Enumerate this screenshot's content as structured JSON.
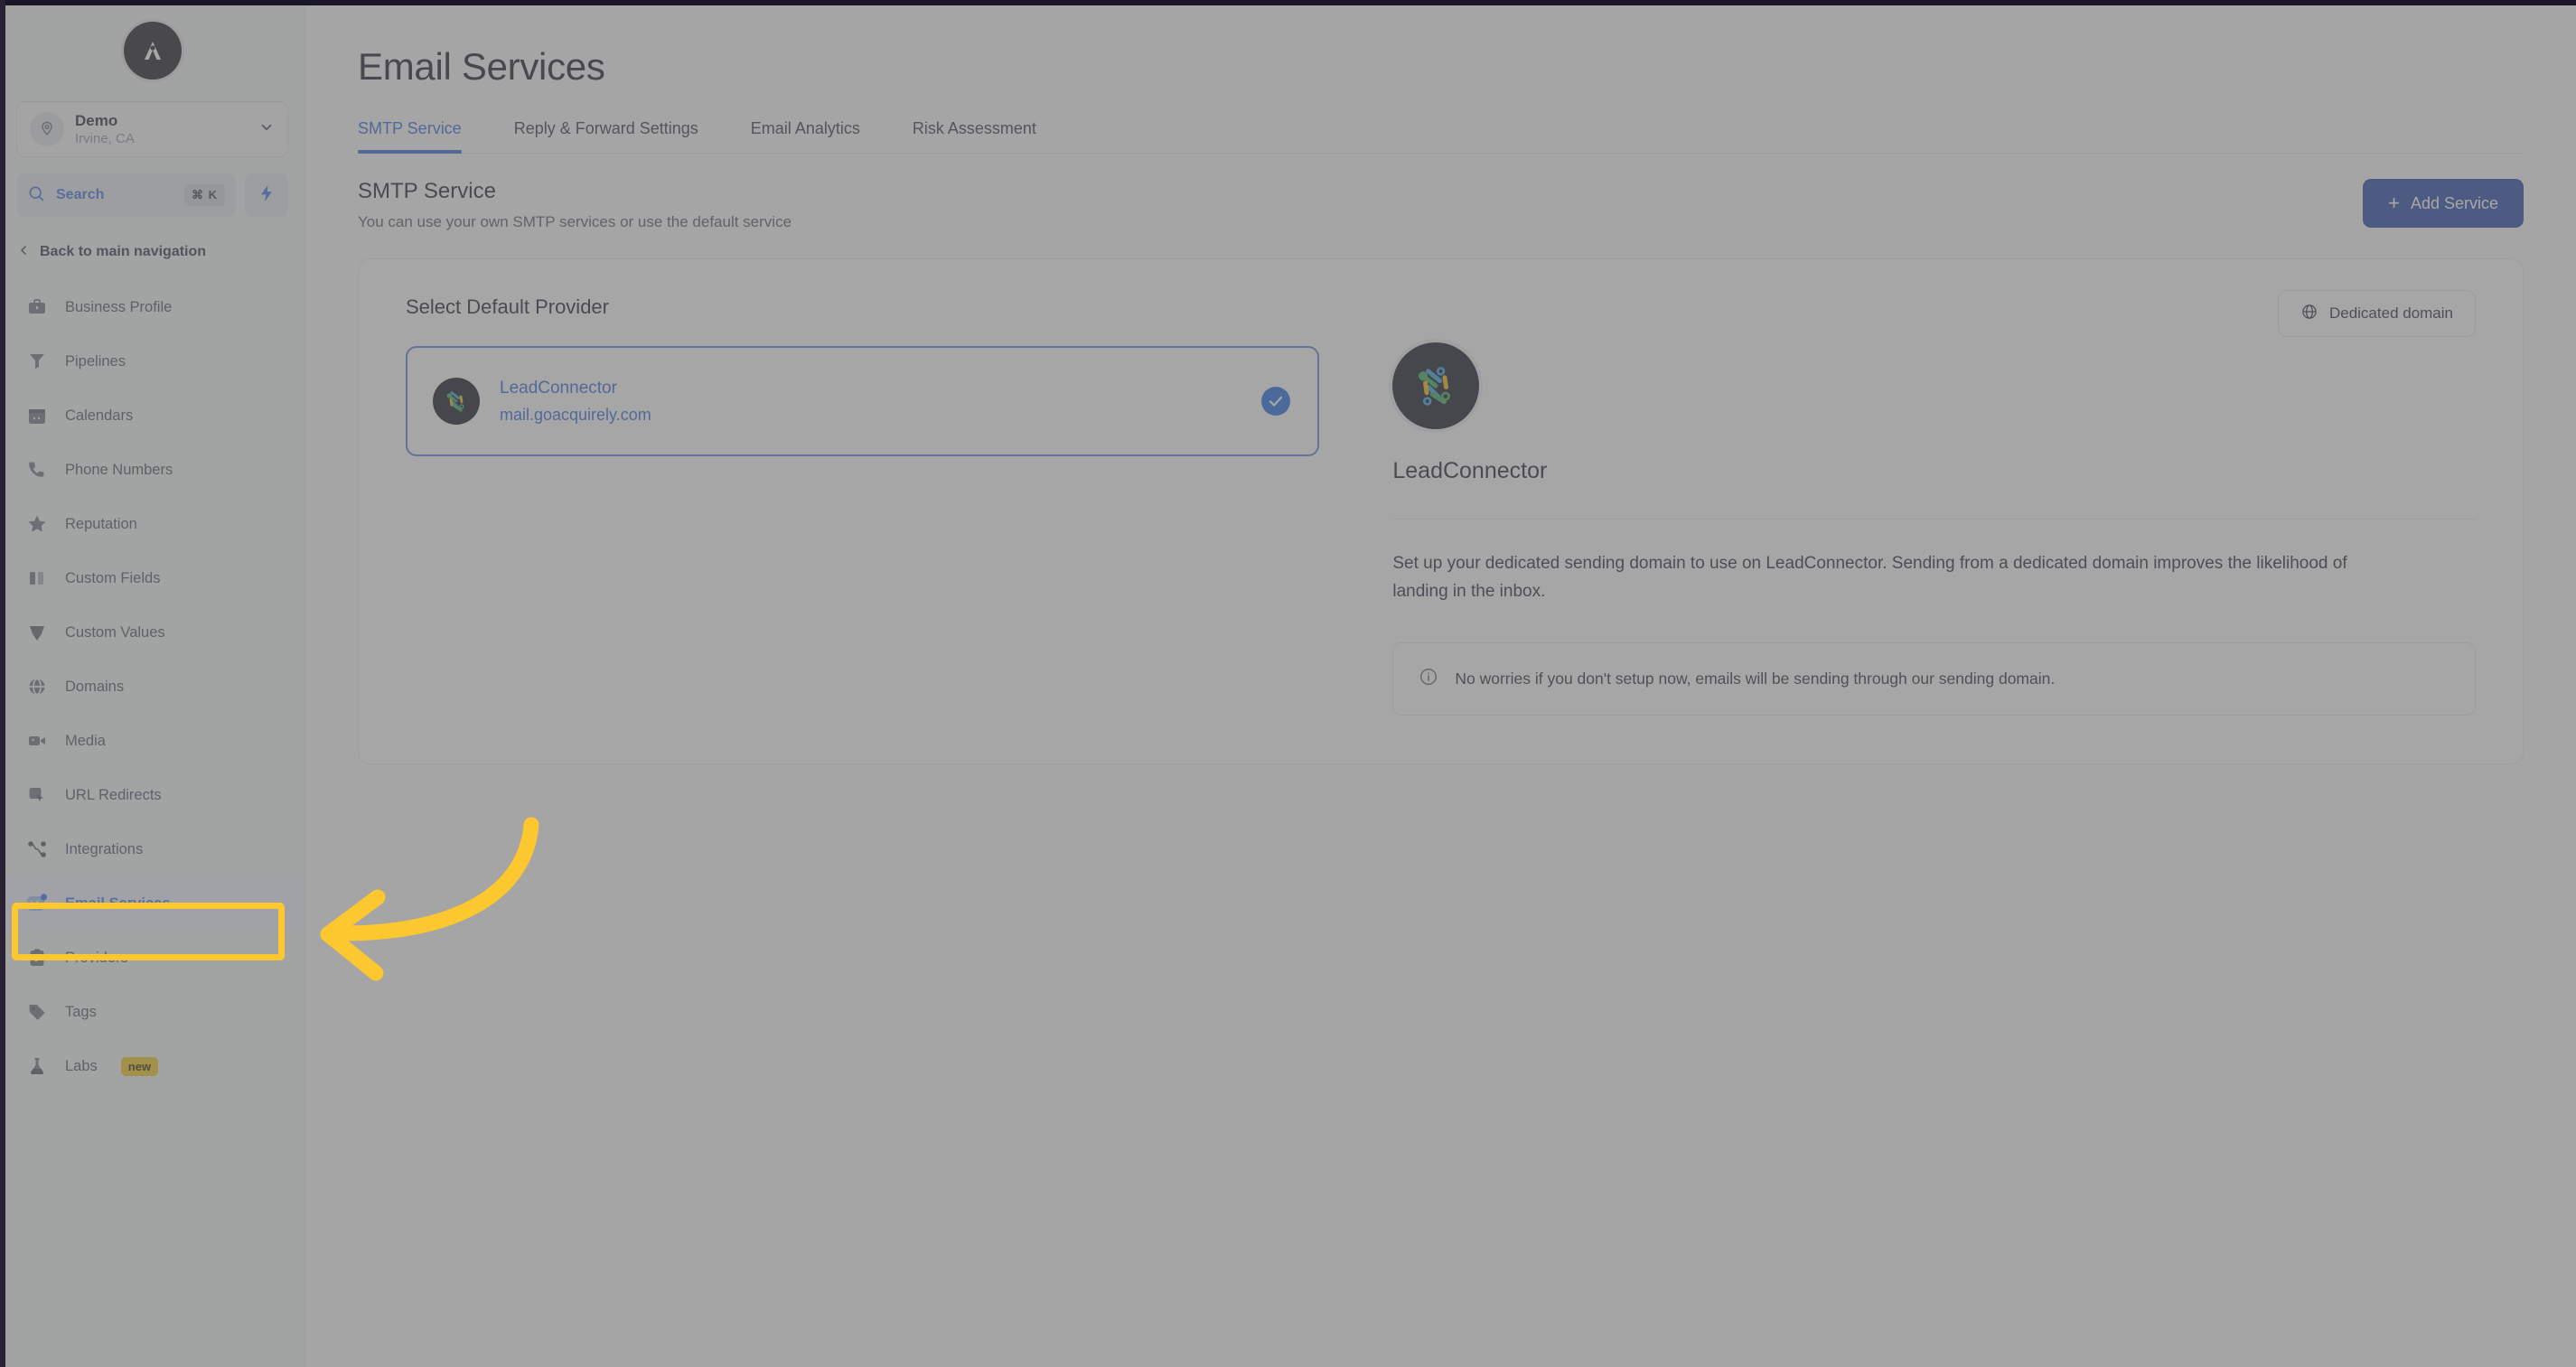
{
  "sidebar": {
    "logo_icon": "logo-a-icon",
    "location": {
      "name": "Demo",
      "sublabel": "Irvine, CA",
      "avatar_icon": "location-pin-icon",
      "chevron_icon": "chevron-down-icon"
    },
    "search": {
      "label": "Search",
      "shortcut": "⌘ K",
      "icon": "search-icon",
      "quick_action_icon": "lightning-bolt-icon"
    },
    "back_nav": {
      "label": "Back to main navigation",
      "icon": "chevron-left-icon"
    },
    "items": [
      {
        "label": "Business Profile",
        "icon": "briefcase-icon",
        "active": false
      },
      {
        "label": "Pipelines",
        "icon": "funnel-icon",
        "active": false
      },
      {
        "label": "Calendars",
        "icon": "calendar-icon",
        "active": false
      },
      {
        "label": "Phone Numbers",
        "icon": "phone-icon",
        "active": false
      },
      {
        "label": "Reputation",
        "icon": "star-icon",
        "active": false
      },
      {
        "label": "Custom Fields",
        "icon": "columns-icon",
        "active": false
      },
      {
        "label": "Custom Values",
        "icon": "shield-icon",
        "active": false
      },
      {
        "label": "Domains",
        "icon": "globe-icon",
        "active": false
      },
      {
        "label": "Media",
        "icon": "video-camera-icon",
        "active": false
      },
      {
        "label": "URL Redirects",
        "icon": "cursor-square-icon",
        "active": false
      },
      {
        "label": "Integrations",
        "icon": "nodes-icon",
        "active": false
      },
      {
        "label": "Email Services",
        "icon": "email-icon",
        "active": true
      },
      {
        "label": "Providers",
        "icon": "clipboard-check-icon",
        "active": false
      },
      {
        "label": "Tags",
        "icon": "tag-icon",
        "active": false
      },
      {
        "label": "Labs",
        "icon": "flask-icon",
        "active": false,
        "badge": "new"
      }
    ]
  },
  "header": {
    "title": "Email Services"
  },
  "tabs": [
    {
      "label": "SMTP Service",
      "active": true
    },
    {
      "label": "Reply & Forward Settings",
      "active": false
    },
    {
      "label": "Email Analytics",
      "active": false
    },
    {
      "label": "Risk Assessment",
      "active": false
    }
  ],
  "section": {
    "title": "SMTP Service",
    "subtitle": "You can use your own SMTP services or use the default service",
    "add_button": {
      "label": "Add Service",
      "icon": "plus-icon"
    }
  },
  "panel": {
    "left": {
      "heading": "Select Default Provider",
      "providers": [
        {
          "name": "LeadConnector",
          "domain": "mail.goacquirely.com",
          "selected": true,
          "logo_icon": "leadconnector-logo-icon",
          "check_icon": "check-circle-icon"
        }
      ]
    },
    "right": {
      "dedicated_domain_button": {
        "label": "Dedicated domain",
        "icon": "globe-icon"
      },
      "logo_icon": "leadconnector-logo-icon",
      "provider_title": "LeadConnector",
      "description": "Set up your dedicated sending domain to use on LeadConnector. Sending from a dedicated domain improves the likelihood of landing in the inbox.",
      "info": {
        "icon": "info-circle-icon",
        "text": "No worries if you don't setup now, emails will be sending through our sending domain."
      }
    }
  },
  "annotations": {
    "highlight_target": "Email Services",
    "highlight_color": "#fdc72f",
    "arrow_icon": "curved-arrow-left-icon"
  },
  "colors": {
    "accent_blue": "#2f63d8",
    "button_blue": "#1e40a0",
    "annotation_yellow": "#fdc72f",
    "active_nav_bg": "#eef2fe"
  }
}
